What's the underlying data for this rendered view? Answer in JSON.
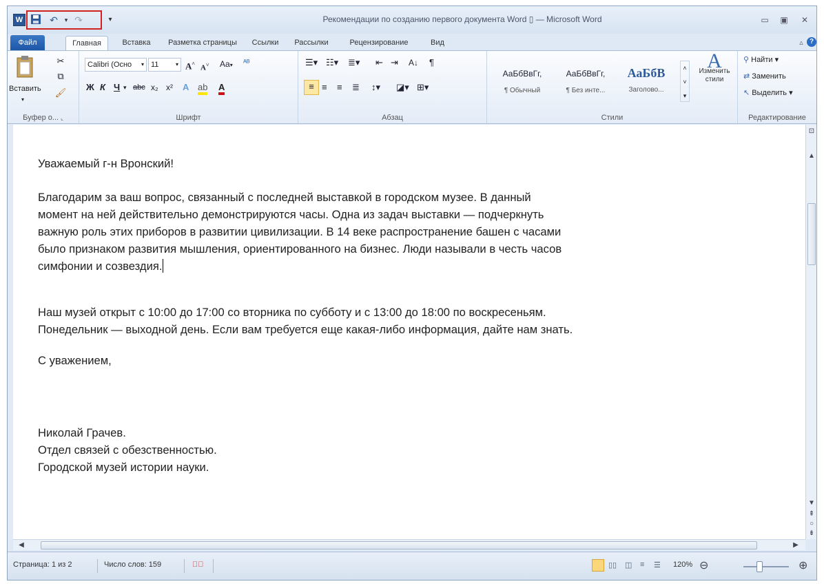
{
  "window": {
    "title": "Рекомендации по созданию первого документа Word ▯ — Microsoft Word",
    "app_icon": "W",
    "qat": {
      "save_icon": "save-icon",
      "undo_icon": "undo-icon",
      "redo_icon": "redo-icon",
      "highlight_color": "#d02020"
    }
  },
  "tabs": [
    "Файл",
    "Главная",
    "Вставка",
    "Разметка страницы",
    "Ссылки",
    "Рассылки",
    "Рецензирование",
    "Вид"
  ],
  "ribbon": {
    "clipboard": {
      "paste_label": "Вставить",
      "group_label": "Буфер о..."
    },
    "font": {
      "font_name": "Calibri (Осно",
      "font_size": "11",
      "bold": "Ж",
      "italic": "К",
      "underline": "Ч",
      "strike": "abc",
      "subscript": "x₂",
      "superscript": "x²",
      "grow": "A",
      "shrink": "A",
      "case": "Aa",
      "group_label": "Шрифт"
    },
    "paragraph": {
      "group_label": "Абзац",
      "pilcrow": "¶"
    },
    "styles": {
      "items": [
        {
          "sample": "АаБбВвГг,",
          "name": "¶ Обычный"
        },
        {
          "sample": "АаБбВвГг,",
          "name": "¶ Без инте..."
        },
        {
          "sample": "АаБбВ",
          "name": "Заголово..."
        }
      ],
      "change_label": "Изменить стили",
      "group_label": "Стили"
    },
    "editing": {
      "find": "Найти",
      "replace": "Заменить",
      "select": "Выделить",
      "group_label": "Редактирование"
    }
  },
  "document": {
    "greeting": "Уважаемый г-н Вронский!",
    "para1": [
      "Благодарим за ваш вопрос, связанный с последней выставкой в городском музее. В данный",
      "момент на ней действительно демонстрируются часы. Одна из задач выставки — подчеркнуть",
      "важную роль этих приборов в развитии цивилизации. В 14 веке распространение башен с часами",
      "было признаком развития мышления, ориентированного на бизнес. Люди называли в честь часов",
      "симфонии и созвездия."
    ],
    "para2": [
      "Наш музей открыт с 10:00 до 17:00 со вторника по субботу и с 13:00 до 18:00 по воскресеньям.",
      "Понедельник — выходной день. Если вам требуется еще какая-либо информация, дайте нам знать."
    ],
    "closing": "С уважением,",
    "signature": [
      "Николай Грачев.",
      "Отдел связей с обезственностью.",
      "Городской музей истории науки."
    ]
  },
  "status": {
    "page": "Страница: 1 из 2",
    "words": "Число слов: 159",
    "zoom": "120%"
  }
}
